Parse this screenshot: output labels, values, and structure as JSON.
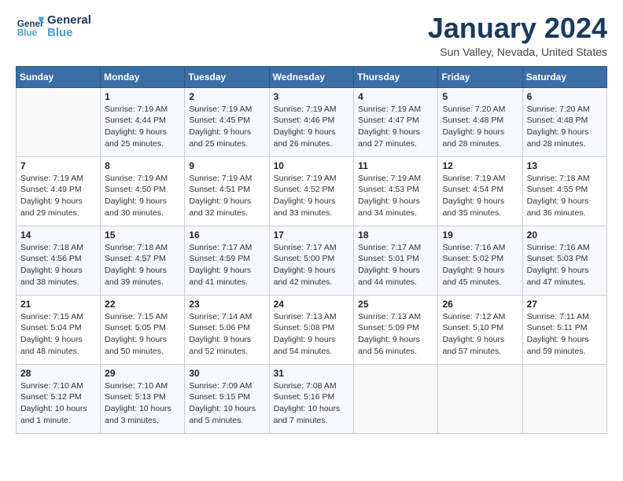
{
  "header": {
    "logo_line1": "General",
    "logo_line2": "Blue",
    "calendar_title": "January 2024",
    "calendar_subtitle": "Sun Valley, Nevada, United States"
  },
  "weekdays": [
    "Sunday",
    "Monday",
    "Tuesday",
    "Wednesday",
    "Thursday",
    "Friday",
    "Saturday"
  ],
  "weeks": [
    [
      {
        "day": "",
        "sunrise": "",
        "sunset": "",
        "daylight": ""
      },
      {
        "day": "1",
        "sunrise": "Sunrise: 7:19 AM",
        "sunset": "Sunset: 4:44 PM",
        "daylight": "Daylight: 9 hours and 25 minutes."
      },
      {
        "day": "2",
        "sunrise": "Sunrise: 7:19 AM",
        "sunset": "Sunset: 4:45 PM",
        "daylight": "Daylight: 9 hours and 25 minutes."
      },
      {
        "day": "3",
        "sunrise": "Sunrise: 7:19 AM",
        "sunset": "Sunset: 4:46 PM",
        "daylight": "Daylight: 9 hours and 26 minutes."
      },
      {
        "day": "4",
        "sunrise": "Sunrise: 7:19 AM",
        "sunset": "Sunset: 4:47 PM",
        "daylight": "Daylight: 9 hours and 27 minutes."
      },
      {
        "day": "5",
        "sunrise": "Sunrise: 7:20 AM",
        "sunset": "Sunset: 4:48 PM",
        "daylight": "Daylight: 9 hours and 28 minutes."
      },
      {
        "day": "6",
        "sunrise": "Sunrise: 7:20 AM",
        "sunset": "Sunset: 4:48 PM",
        "daylight": "Daylight: 9 hours and 28 minutes."
      }
    ],
    [
      {
        "day": "7",
        "sunrise": "Sunrise: 7:19 AM",
        "sunset": "Sunset: 4:49 PM",
        "daylight": "Daylight: 9 hours and 29 minutes."
      },
      {
        "day": "8",
        "sunrise": "Sunrise: 7:19 AM",
        "sunset": "Sunset: 4:50 PM",
        "daylight": "Daylight: 9 hours and 30 minutes."
      },
      {
        "day": "9",
        "sunrise": "Sunrise: 7:19 AM",
        "sunset": "Sunset: 4:51 PM",
        "daylight": "Daylight: 9 hours and 32 minutes."
      },
      {
        "day": "10",
        "sunrise": "Sunrise: 7:19 AM",
        "sunset": "Sunset: 4:52 PM",
        "daylight": "Daylight: 9 hours and 33 minutes."
      },
      {
        "day": "11",
        "sunrise": "Sunrise: 7:19 AM",
        "sunset": "Sunset: 4:53 PM",
        "daylight": "Daylight: 9 hours and 34 minutes."
      },
      {
        "day": "12",
        "sunrise": "Sunrise: 7:19 AM",
        "sunset": "Sunset: 4:54 PM",
        "daylight": "Daylight: 9 hours and 35 minutes."
      },
      {
        "day": "13",
        "sunrise": "Sunrise: 7:18 AM",
        "sunset": "Sunset: 4:55 PM",
        "daylight": "Daylight: 9 hours and 36 minutes."
      }
    ],
    [
      {
        "day": "14",
        "sunrise": "Sunrise: 7:18 AM",
        "sunset": "Sunset: 4:56 PM",
        "daylight": "Daylight: 9 hours and 38 minutes."
      },
      {
        "day": "15",
        "sunrise": "Sunrise: 7:18 AM",
        "sunset": "Sunset: 4:57 PM",
        "daylight": "Daylight: 9 hours and 39 minutes."
      },
      {
        "day": "16",
        "sunrise": "Sunrise: 7:17 AM",
        "sunset": "Sunset: 4:59 PM",
        "daylight": "Daylight: 9 hours and 41 minutes."
      },
      {
        "day": "17",
        "sunrise": "Sunrise: 7:17 AM",
        "sunset": "Sunset: 5:00 PM",
        "daylight": "Daylight: 9 hours and 42 minutes."
      },
      {
        "day": "18",
        "sunrise": "Sunrise: 7:17 AM",
        "sunset": "Sunset: 5:01 PM",
        "daylight": "Daylight: 9 hours and 44 minutes."
      },
      {
        "day": "19",
        "sunrise": "Sunrise: 7:16 AM",
        "sunset": "Sunset: 5:02 PM",
        "daylight": "Daylight: 9 hours and 45 minutes."
      },
      {
        "day": "20",
        "sunrise": "Sunrise: 7:16 AM",
        "sunset": "Sunset: 5:03 PM",
        "daylight": "Daylight: 9 hours and 47 minutes."
      }
    ],
    [
      {
        "day": "21",
        "sunrise": "Sunrise: 7:15 AM",
        "sunset": "Sunset: 5:04 PM",
        "daylight": "Daylight: 9 hours and 48 minutes."
      },
      {
        "day": "22",
        "sunrise": "Sunrise: 7:15 AM",
        "sunset": "Sunset: 5:05 PM",
        "daylight": "Daylight: 9 hours and 50 minutes."
      },
      {
        "day": "23",
        "sunrise": "Sunrise: 7:14 AM",
        "sunset": "Sunset: 5:06 PM",
        "daylight": "Daylight: 9 hours and 52 minutes."
      },
      {
        "day": "24",
        "sunrise": "Sunrise: 7:13 AM",
        "sunset": "Sunset: 5:08 PM",
        "daylight": "Daylight: 9 hours and 54 minutes."
      },
      {
        "day": "25",
        "sunrise": "Sunrise: 7:13 AM",
        "sunset": "Sunset: 5:09 PM",
        "daylight": "Daylight: 9 hours and 56 minutes."
      },
      {
        "day": "26",
        "sunrise": "Sunrise: 7:12 AM",
        "sunset": "Sunset: 5:10 PM",
        "daylight": "Daylight: 9 hours and 57 minutes."
      },
      {
        "day": "27",
        "sunrise": "Sunrise: 7:11 AM",
        "sunset": "Sunset: 5:11 PM",
        "daylight": "Daylight: 9 hours and 59 minutes."
      }
    ],
    [
      {
        "day": "28",
        "sunrise": "Sunrise: 7:10 AM",
        "sunset": "Sunset: 5:12 PM",
        "daylight": "Daylight: 10 hours and 1 minute."
      },
      {
        "day": "29",
        "sunrise": "Sunrise: 7:10 AM",
        "sunset": "Sunset: 5:13 PM",
        "daylight": "Daylight: 10 hours and 3 minutes."
      },
      {
        "day": "30",
        "sunrise": "Sunrise: 7:09 AM",
        "sunset": "Sunset: 5:15 PM",
        "daylight": "Daylight: 10 hours and 5 minutes."
      },
      {
        "day": "31",
        "sunrise": "Sunrise: 7:08 AM",
        "sunset": "Sunset: 5:16 PM",
        "daylight": "Daylight: 10 hours and 7 minutes."
      },
      {
        "day": "",
        "sunrise": "",
        "sunset": "",
        "daylight": ""
      },
      {
        "day": "",
        "sunrise": "",
        "sunset": "",
        "daylight": ""
      },
      {
        "day": "",
        "sunrise": "",
        "sunset": "",
        "daylight": ""
      }
    ]
  ]
}
